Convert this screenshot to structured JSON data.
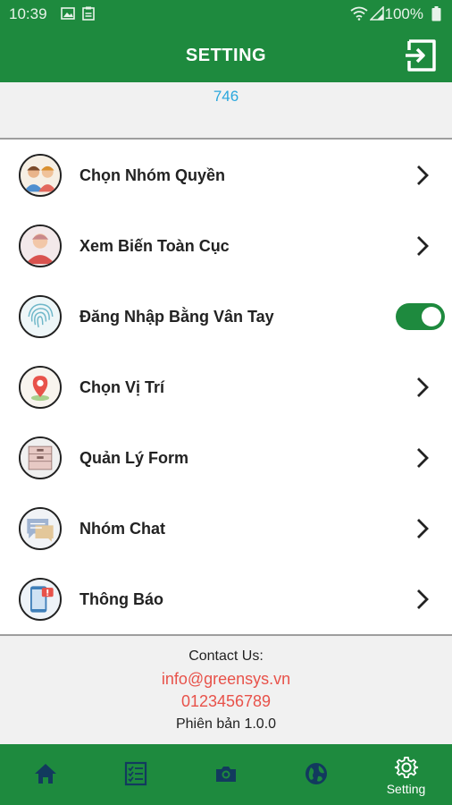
{
  "status_bar": {
    "time": "10:39",
    "battery": "100%"
  },
  "header": {
    "title": "SETTING"
  },
  "user": {
    "id": "746"
  },
  "menu": [
    {
      "label": "Chọn Nhóm Quyền",
      "control": "chevron"
    },
    {
      "label": "Xem Biến Toàn Cục",
      "control": "chevron"
    },
    {
      "label": "Đăng Nhập Bằng Vân Tay",
      "control": "toggle",
      "toggle_on": true
    },
    {
      "label": "Chọn Vị Trí",
      "control": "chevron"
    },
    {
      "label": "Quản Lý Form",
      "control": "chevron"
    },
    {
      "label": "Nhóm Chat",
      "control": "chevron"
    },
    {
      "label": "Thông Báo",
      "control": "chevron"
    }
  ],
  "contact": {
    "title": "Contact Us:",
    "email": "info@greensys.vn",
    "phone": "0123456789",
    "version": "Phiên bản 1.0.0"
  },
  "bottom_nav": [
    {
      "icon": "home-icon",
      "label": ""
    },
    {
      "icon": "checklist-icon",
      "label": ""
    },
    {
      "icon": "camera-icon",
      "label": ""
    },
    {
      "icon": "globe-icon",
      "label": ""
    },
    {
      "icon": "gear-icon",
      "label": "Setting",
      "active": true
    }
  ],
  "colors": {
    "primary": "#1e8a3e",
    "link_blue": "#2aa7dd",
    "contact_red": "#e8524a",
    "toggle_on": "#1e8a3e"
  }
}
